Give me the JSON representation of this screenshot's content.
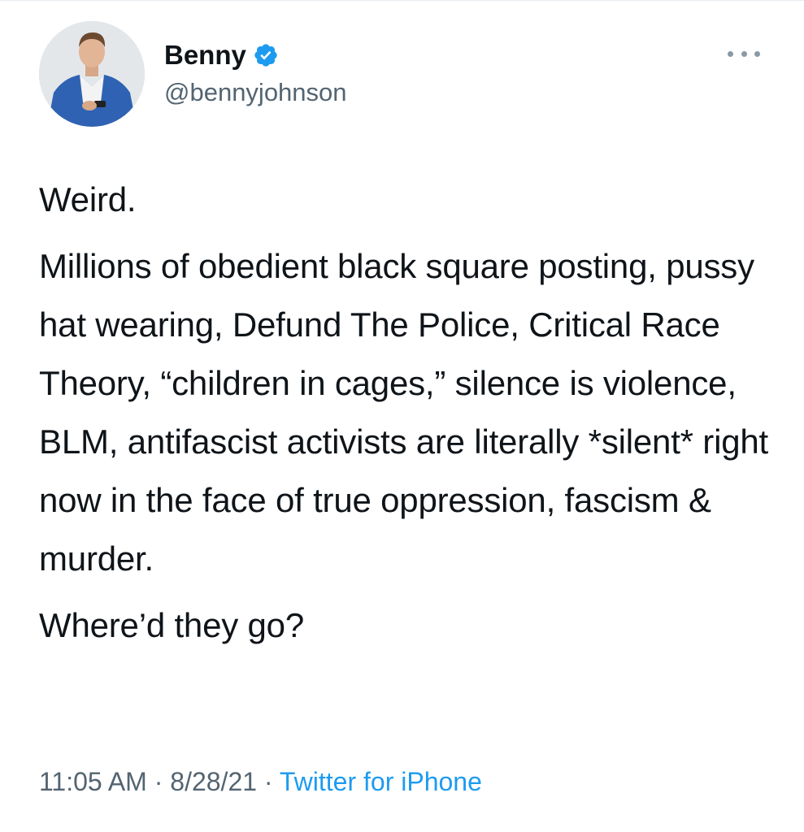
{
  "user": {
    "display_name": "Benny",
    "handle": "@bennyjohnson",
    "verified": true
  },
  "icons": {
    "verified": "verified-badge-icon",
    "more": "more-options-icon",
    "avatar": "profile-avatar"
  },
  "colors": {
    "text": "#0f1419",
    "secondary": "#536471",
    "link": "#1d9bf0",
    "verified": "#1d9bf0"
  },
  "tweet": {
    "paragraphs": [
      "Weird.",
      "Millions of obedient black square posting, pussy hat wearing, Defund The Police, Critical Race Theory, “children in cages,” silence is violence, BLM, antifascist activists are literally *silent* right now in the face of true oppression, fascism & murder.",
      "Where’d they go?"
    ],
    "time": "11:05 AM",
    "separator": "·",
    "date": "8/28/21",
    "source": "Twitter for iPhone"
  }
}
